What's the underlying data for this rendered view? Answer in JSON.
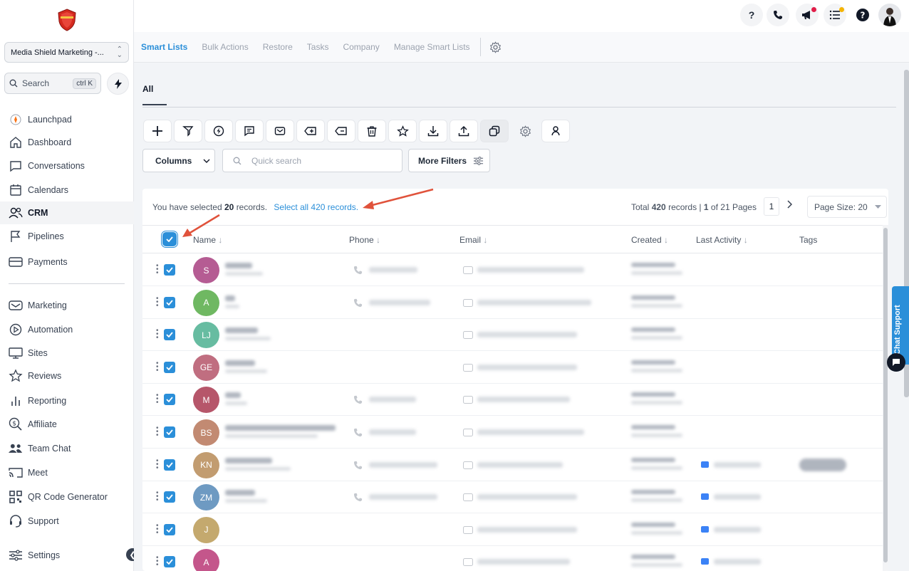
{
  "sidebar": {
    "account": "Media Shield Marketing -...",
    "search": {
      "label": "Search",
      "shortcut": "ctrl K"
    },
    "items": [
      {
        "label": "Launchpad",
        "icon": "launchpad-icon"
      },
      {
        "label": "Dashboard",
        "icon": "home-icon"
      },
      {
        "label": "Conversations",
        "icon": "chat-icon"
      },
      {
        "label": "Calendars",
        "icon": "calendar-icon"
      },
      {
        "label": "CRM",
        "icon": "users-icon"
      },
      {
        "label": "Pipelines",
        "icon": "flag-icon"
      },
      {
        "label": "Payments",
        "icon": "card-icon"
      },
      {
        "label": "Marketing",
        "icon": "mail-icon"
      },
      {
        "label": "Automation",
        "icon": "play-icon"
      },
      {
        "label": "Sites",
        "icon": "monitor-icon"
      },
      {
        "label": "Reviews",
        "icon": "star-icon"
      },
      {
        "label": "Reporting",
        "icon": "bar-chart-icon"
      },
      {
        "label": "Affiliate",
        "icon": "dollar-search-icon"
      },
      {
        "label": "Team Chat",
        "icon": "team-icon"
      },
      {
        "label": "Meet",
        "icon": "cast-icon"
      },
      {
        "label": "QR Code Generator",
        "icon": "qr-icon"
      },
      {
        "label": "Support",
        "icon": "headset-icon"
      },
      {
        "label": "Settings",
        "icon": "sliders-icon"
      }
    ]
  },
  "subnav": {
    "tabs": [
      "Smart Lists",
      "Bulk Actions",
      "Restore",
      "Tasks",
      "Company",
      "Manage Smart Lists"
    ]
  },
  "main": {
    "tab_all": "All",
    "columns_label": "Columns",
    "quick_search_placeholder": "Quick search",
    "more_filters_label": "More Filters"
  },
  "table": {
    "selection": {
      "prefix": "You have selected",
      "count": "20",
      "suffix": "records.",
      "link": "Select all 420 records."
    },
    "total": {
      "prefix": "Total",
      "count": "420",
      "mid": "records |",
      "page": "1",
      "suffix": "of 21 Pages"
    },
    "current_page": "1",
    "page_size": "Page Size: 20",
    "headers": {
      "name": "Name",
      "phone": "Phone",
      "email": "Email",
      "created": "Created",
      "last_activity": "Last Activity",
      "tags": "Tags"
    },
    "rows": [
      {
        "initials": "S",
        "color": "#b55c93"
      },
      {
        "initials": "A",
        "color": "#6fb862"
      },
      {
        "initials": "LJ",
        "color": "#67bca1"
      },
      {
        "initials": "GE",
        "color": "#c06e80"
      },
      {
        "initials": "M",
        "color": "#b6566a"
      },
      {
        "initials": "BS",
        "color": "#c28a72"
      },
      {
        "initials": "KN",
        "color": "#c29c70"
      },
      {
        "initials": "ZM",
        "color": "#6e9ac2"
      },
      {
        "initials": "J",
        "color": "#c4a96e"
      },
      {
        "initials": "A",
        "color": "#c4568b"
      }
    ]
  },
  "chat_support": "Chat Support",
  "colors": {
    "accent": "#2b8fd9",
    "arrow": "#e0523b"
  }
}
